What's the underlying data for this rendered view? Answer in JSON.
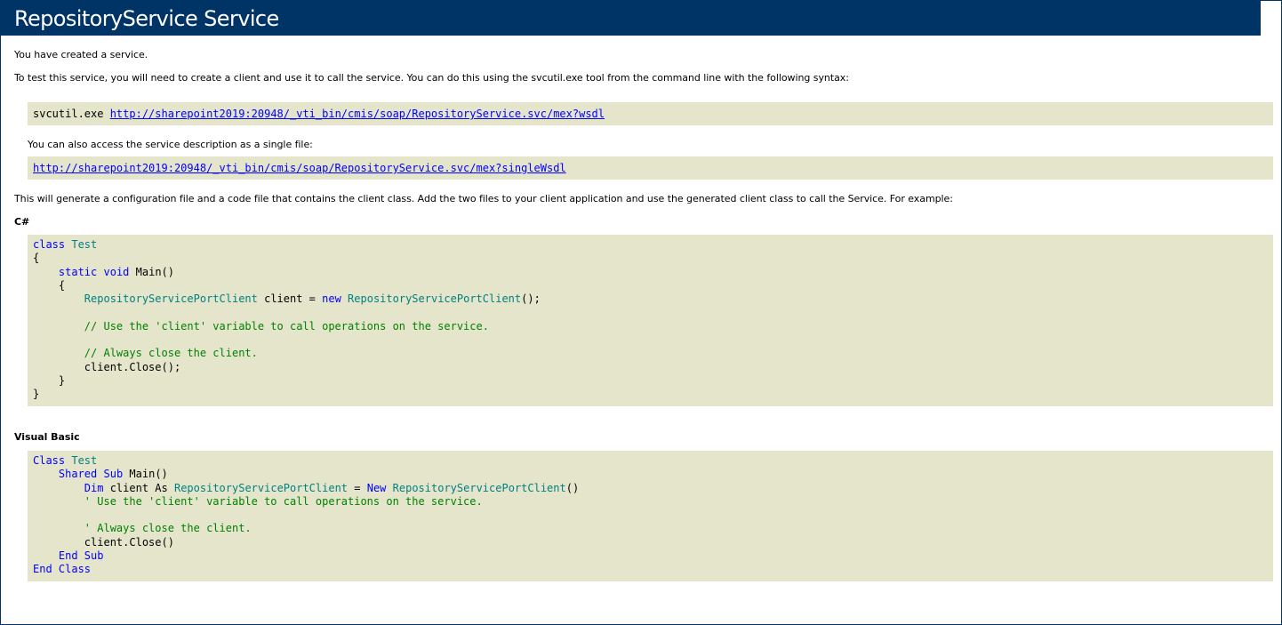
{
  "page": {
    "title": "RepositoryService Service",
    "intro": "You have created a service.",
    "test_instructions": "To test this service, you will need to create a client and use it to call the service. You can do this using the svcutil.exe tool from the command line with the following syntax:",
    "svcutil_cmd": "svcutil.exe ",
    "wsdl_url": "http://sharepoint2019:20948/_vti_bin/cmis/soap/RepositoryService.svc/mex?wsdl",
    "single_file_text": "You can also access the service description as a single file:",
    "single_wsdl_url": "http://sharepoint2019:20948/_vti_bin/cmis/soap/RepositoryService.svc/mex?singleWsdl",
    "generate_text": "This will generate a configuration file and a code file that contains the client class. Add the two files to your client application and use the generated client class to call the Service. For example:",
    "csharp_label": "C#",
    "vb_label": "Visual Basic"
  },
  "csharp": {
    "kw_class": "class",
    "type_test": "Test",
    "open_brace": "{",
    "kw_static": "static",
    "kw_void": "void",
    "main": "Main()",
    "inner_open": "{",
    "type_client": "RepositoryServicePortClient",
    "client_eq": " client = ",
    "kw_new": "new",
    "type_client2": "RepositoryServicePortClient",
    "ctor_end": "();",
    "comment_use": "// Use the 'client' variable to call operations on the service.",
    "comment_close": "// Always close the client.",
    "close_call": "client.Close();",
    "inner_close": "}",
    "close_brace": "}"
  },
  "vb": {
    "kw_class": "Class",
    "type_test": "Test",
    "kw_shared": "Shared",
    "kw_sub": "Sub",
    "main": "Main()",
    "kw_dim": "Dim",
    "client_as": " client As ",
    "type_client": "RepositoryServicePortClient",
    "eq": " = ",
    "kw_new": "New",
    "type_client2": "RepositoryServicePortClient",
    "ctor_end": "()",
    "comment_use": "' Use the 'client' variable to call operations on the service.",
    "comment_close": "' Always close the client.",
    "close_call": "client.Close()",
    "kw_end_sub": "End Sub",
    "kw_end_class": "End Class"
  }
}
